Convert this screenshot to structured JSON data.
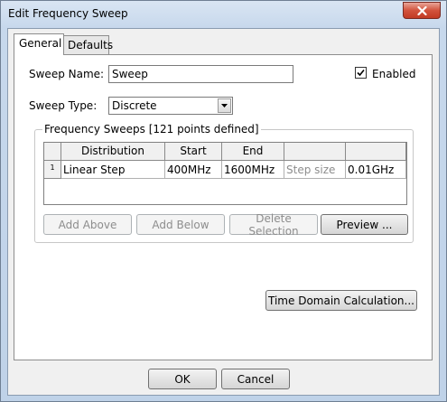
{
  "window": {
    "title": "Edit Frequency Sweep"
  },
  "tabs": [
    {
      "label": "General",
      "active": true
    },
    {
      "label": "Defaults",
      "active": false
    }
  ],
  "general": {
    "sweep_name_label": "Sweep Name:",
    "sweep_name_value": "Sweep",
    "enabled_label": "Enabled",
    "enabled_checked": true,
    "sweep_type_label": "Sweep Type:",
    "sweep_type_value": "Discrete",
    "group_title": "Frequency Sweeps [121 points defined]",
    "table": {
      "columns": [
        "Distribution",
        "Start",
        "End",
        "",
        ""
      ],
      "rows": [
        {
          "num": "1",
          "cells": [
            "Linear Step",
            "400MHz",
            "1600MHz",
            "Step size",
            "0.01GHz"
          ]
        }
      ]
    },
    "buttons": {
      "add_above": "Add Above",
      "add_below": "Add Below",
      "delete_selection": "Delete Selection",
      "preview": "Preview ...",
      "time_domain": "Time Domain Calculation..."
    }
  },
  "footer": {
    "ok": "OK",
    "cancel": "Cancel"
  }
}
